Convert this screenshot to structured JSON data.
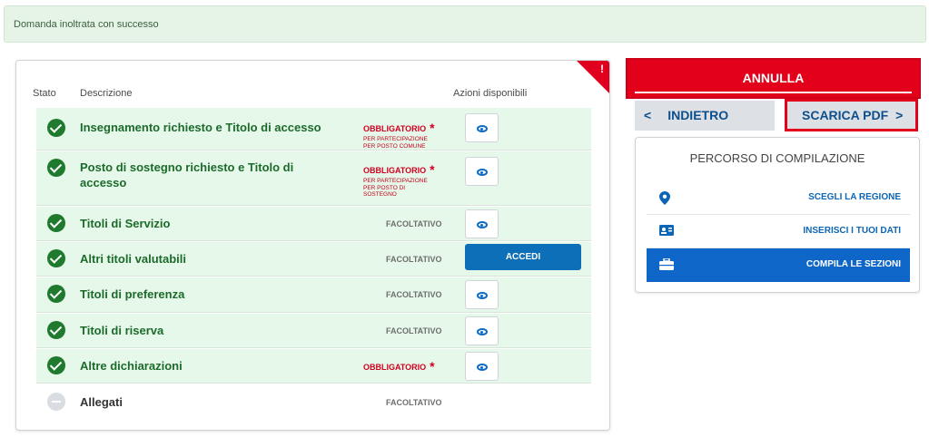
{
  "alert": {
    "text": "Domanda inoltrata con successo"
  },
  "table": {
    "headers": {
      "stato": "Stato",
      "descrizione": "Descrizione",
      "azioni": "Azioni disponibili"
    },
    "corner_mark": "!",
    "rows": [
      {
        "status": "done",
        "label": "Insegnamento richiesto e Titolo di accesso",
        "requirement": "OBBLIGATORIO",
        "note": "PER PARTECIPAZIONE\nPER POSTO COMUNE",
        "action": "view"
      },
      {
        "status": "done",
        "label": "Posto di sostegno richiesto e Titolo di accesso",
        "requirement": "OBBLIGATORIO",
        "note": "PER PARTECIPAZIONE\nPER POSTO DI\nSOSTEGNO",
        "action": "view"
      },
      {
        "status": "done",
        "label": "Titoli di Servizio",
        "requirement": "FACOLTATIVO",
        "action": "view"
      },
      {
        "status": "done",
        "label": "Altri titoli valutabili",
        "requirement": "FACOLTATIVO",
        "action": "accedi"
      },
      {
        "status": "done",
        "label": "Titoli di preferenza",
        "requirement": "FACOLTATIVO",
        "action": "view"
      },
      {
        "status": "done",
        "label": "Titoli di riserva",
        "requirement": "FACOLTATIVO",
        "action": "view"
      },
      {
        "status": "done",
        "label": "Altre dichiarazioni",
        "requirement": "OBBLIGATORIO",
        "action": "view"
      },
      {
        "status": "pending",
        "label": "Allegati",
        "requirement": "FACOLTATIVO",
        "action": "none"
      }
    ],
    "star": "*",
    "accedi_label": "ACCEDI"
  },
  "actions": {
    "annulla": "ANNULLA",
    "indietro": "INDIETRO",
    "indietro_icon": "<",
    "scarica": "SCARICA PDF",
    "scarica_icon": ">"
  },
  "percorso": {
    "title": "PERCORSO DI COMPILAZIONE",
    "items": [
      {
        "label": "SCEGLI LA REGIONE",
        "icon": "map-pin-icon"
      },
      {
        "label": "INSERISCI I TUOI DATI",
        "icon": "id-card-icon"
      },
      {
        "label": "COMPILA LE SEZIONI",
        "icon": "briefcase-icon"
      }
    ]
  },
  "colors": {
    "success_bg": "#e6f8ea",
    "danger": "#e2001a",
    "primary": "#0d66c8"
  }
}
